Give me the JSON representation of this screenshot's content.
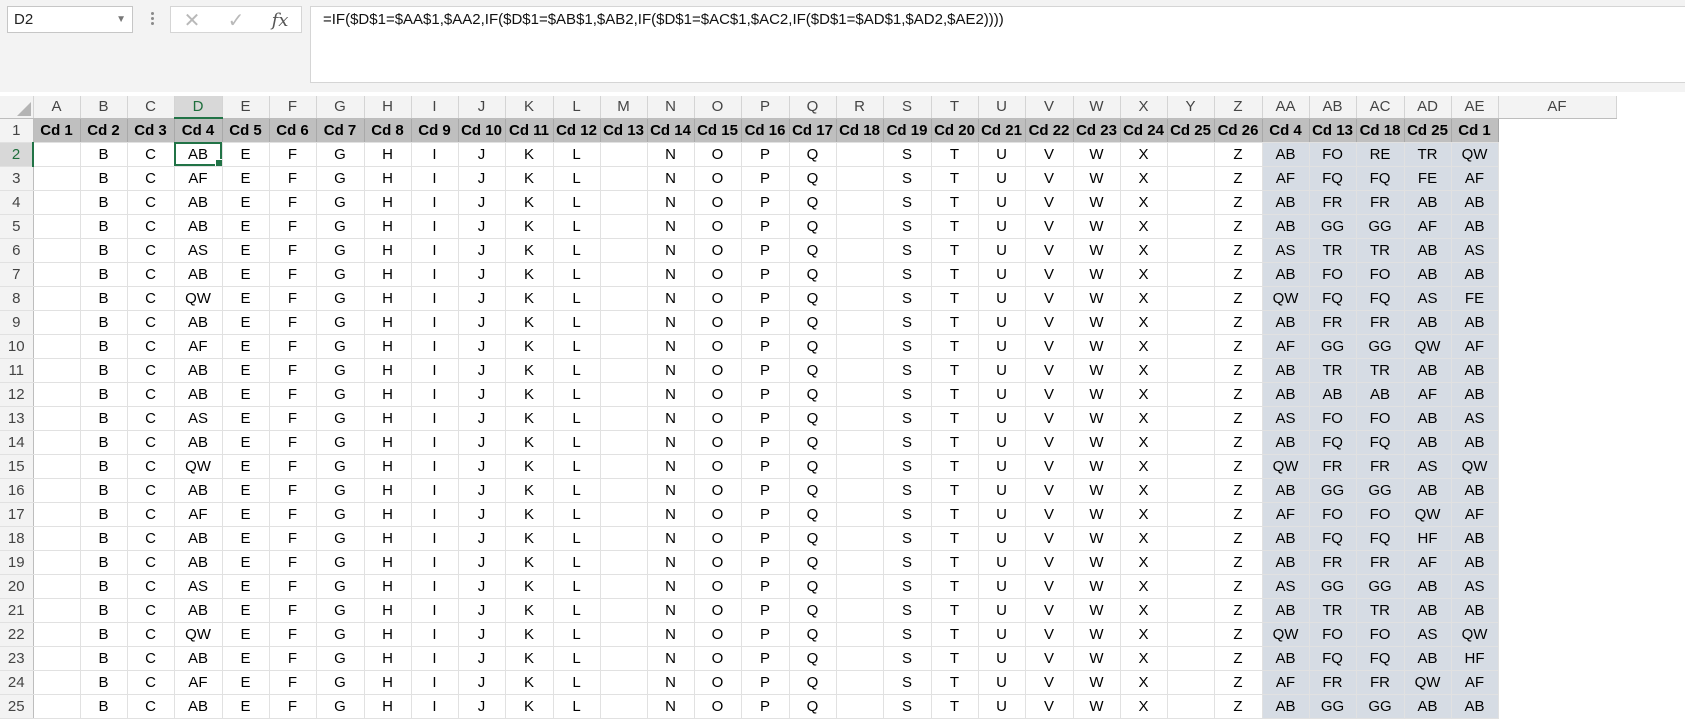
{
  "name_box": "D2",
  "formula": "=IF($D$1=$AA$1,$AA2,IF($D$1=$AB$1,$AB2,IF($D$1=$AC$1,$AC2,IF($D$1=$AD$1,$AD2,$AE2))))",
  "icons": {
    "cancel": "close-icon",
    "enter": "check-icon",
    "function": "fx-icon"
  },
  "colors": {
    "header_fill": "#bfbfbf",
    "helper_fill": "#d6dce4",
    "selection": "#217346"
  },
  "columns": [
    "A",
    "B",
    "C",
    "D",
    "E",
    "F",
    "G",
    "H",
    "I",
    "J",
    "K",
    "L",
    "M",
    "N",
    "O",
    "P",
    "Q",
    "R",
    "S",
    "T",
    "U",
    "V",
    "W",
    "X",
    "Y",
    "Z",
    "AA",
    "AB",
    "AC",
    "AD",
    "AE",
    "AF"
  ],
  "header_row": [
    "Cd 1",
    "Cd 2",
    "Cd 3",
    "Cd 4",
    "Cd 5",
    "Cd 6",
    "Cd 7",
    "Cd 8",
    "Cd 9",
    "Cd 10",
    "Cd 11",
    "Cd 12",
    "Cd 13",
    "Cd 14",
    "Cd 15",
    "Cd 16",
    "Cd 17",
    "Cd 18",
    "Cd 19",
    "Cd 20",
    "Cd 21",
    "Cd 22",
    "Cd 23",
    "Cd 24",
    "Cd 25",
    "Cd 26",
    "Cd 4",
    "Cd 13",
    "Cd 18",
    "Cd 25",
    "Cd 1",
    ""
  ],
  "static_row_values": [
    "",
    "B",
    "C",
    "",
    "E",
    "F",
    "G",
    "H",
    "I",
    "J",
    "K",
    "L",
    "",
    "N",
    "O",
    "P",
    "Q",
    "",
    "S",
    "T",
    "U",
    "V",
    "W",
    "X",
    "",
    "Z"
  ],
  "rows": [
    {
      "n": "2",
      "d": "AB",
      "helper": [
        "AB",
        "FO",
        "RE",
        "TR",
        "QW"
      ]
    },
    {
      "n": "3",
      "d": "AF",
      "helper": [
        "AF",
        "FQ",
        "FQ",
        "FE",
        "AF"
      ]
    },
    {
      "n": "4",
      "d": "AB",
      "helper": [
        "AB",
        "FR",
        "FR",
        "AB",
        "AB"
      ]
    },
    {
      "n": "5",
      "d": "AB",
      "helper": [
        "AB",
        "GG",
        "GG",
        "AF",
        "AB"
      ]
    },
    {
      "n": "6",
      "d": "AS",
      "helper": [
        "AS",
        "TR",
        "TR",
        "AB",
        "AS"
      ]
    },
    {
      "n": "7",
      "d": "AB",
      "helper": [
        "AB",
        "FO",
        "FO",
        "AB",
        "AB"
      ]
    },
    {
      "n": "8",
      "d": "QW",
      "helper": [
        "QW",
        "FQ",
        "FQ",
        "AS",
        "FE"
      ]
    },
    {
      "n": "9",
      "d": "AB",
      "helper": [
        "AB",
        "FR",
        "FR",
        "AB",
        "AB"
      ]
    },
    {
      "n": "10",
      "d": "AF",
      "helper": [
        "AF",
        "GG",
        "GG",
        "QW",
        "AF"
      ]
    },
    {
      "n": "11",
      "d": "AB",
      "helper": [
        "AB",
        "TR",
        "TR",
        "AB",
        "AB"
      ]
    },
    {
      "n": "12",
      "d": "AB",
      "helper": [
        "AB",
        "AB",
        "AB",
        "AF",
        "AB"
      ]
    },
    {
      "n": "13",
      "d": "AS",
      "helper": [
        "AS",
        "FO",
        "FO",
        "AB",
        "AS"
      ]
    },
    {
      "n": "14",
      "d": "AB",
      "helper": [
        "AB",
        "FQ",
        "FQ",
        "AB",
        "AB"
      ]
    },
    {
      "n": "15",
      "d": "QW",
      "helper": [
        "QW",
        "FR",
        "FR",
        "AS",
        "QW"
      ]
    },
    {
      "n": "16",
      "d": "AB",
      "helper": [
        "AB",
        "GG",
        "GG",
        "AB",
        "AB"
      ]
    },
    {
      "n": "17",
      "d": "AF",
      "helper": [
        "AF",
        "FO",
        "FO",
        "QW",
        "AF"
      ]
    },
    {
      "n": "18",
      "d": "AB",
      "helper": [
        "AB",
        "FQ",
        "FQ",
        "HF",
        "AB"
      ]
    },
    {
      "n": "19",
      "d": "AB",
      "helper": [
        "AB",
        "FR",
        "FR",
        "AF",
        "AB"
      ]
    },
    {
      "n": "20",
      "d": "AS",
      "helper": [
        "AS",
        "GG",
        "GG",
        "AB",
        "AS"
      ]
    },
    {
      "n": "21",
      "d": "AB",
      "helper": [
        "AB",
        "TR",
        "TR",
        "AB",
        "AB"
      ]
    },
    {
      "n": "22",
      "d": "QW",
      "helper": [
        "QW",
        "FO",
        "FO",
        "AS",
        "QW"
      ]
    },
    {
      "n": "23",
      "d": "AB",
      "helper": [
        "AB",
        "FQ",
        "FQ",
        "AB",
        "HF"
      ]
    },
    {
      "n": "24",
      "d": "AF",
      "helper": [
        "AF",
        "FR",
        "FR",
        "QW",
        "AF"
      ]
    },
    {
      "n": "25",
      "d": "AB",
      "helper": [
        "AB",
        "GG",
        "GG",
        "AB",
        "AB"
      ]
    }
  ],
  "selected_cell": "D2"
}
